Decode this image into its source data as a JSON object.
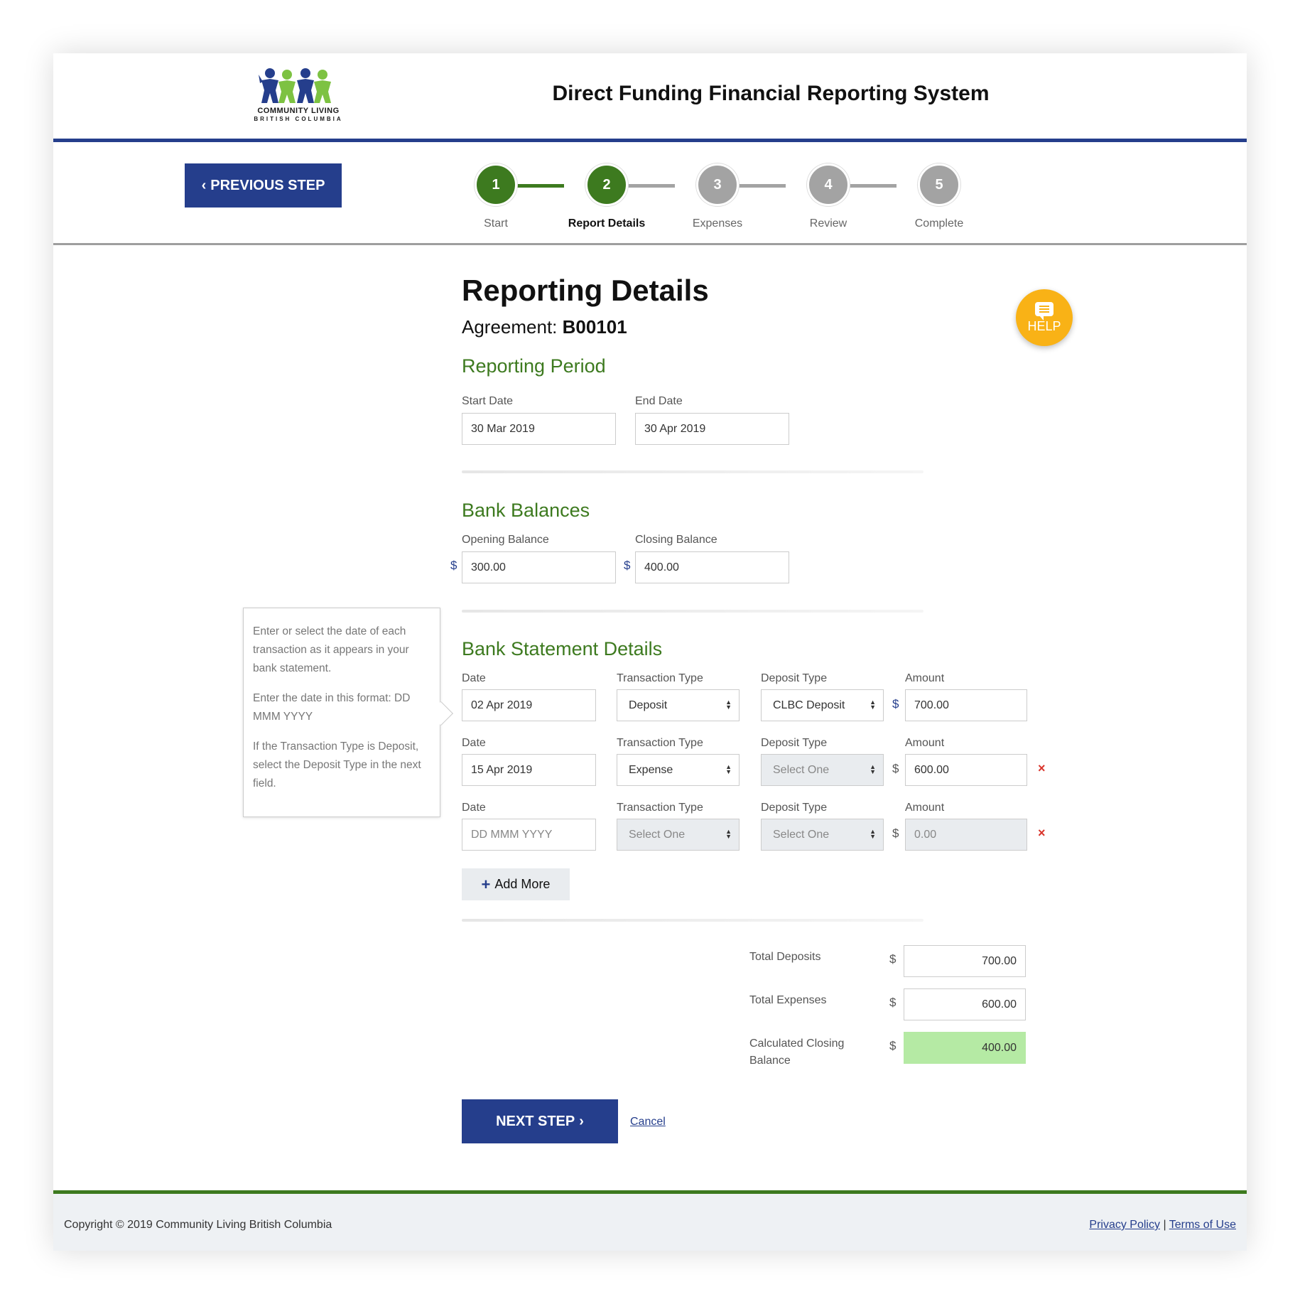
{
  "header": {
    "logo_line1": "COMMUNITY LIVING",
    "logo_line2": "BRITISH COLUMBIA",
    "system_title": "Direct Funding Financial Reporting System"
  },
  "nav": {
    "previous_label": "PREVIOUS STEP",
    "steps": [
      {
        "number": "1",
        "label": "Start",
        "state": "done"
      },
      {
        "number": "2",
        "label": "Report Details",
        "state": "active"
      },
      {
        "number": "3",
        "label": "Expenses",
        "state": "todo"
      },
      {
        "number": "4",
        "label": "Review",
        "state": "todo"
      },
      {
        "number": "5",
        "label": "Complete",
        "state": "todo"
      }
    ]
  },
  "page": {
    "title": "Reporting Details",
    "agreement_label": "Agreement:",
    "agreement_number": "B00101"
  },
  "reporting_period": {
    "title": "Reporting Period",
    "start_label": "Start Date",
    "start_value": "30 Mar 2019",
    "end_label": "End Date",
    "end_value": "30 Apr 2019"
  },
  "bank_balances": {
    "title": "Bank Balances",
    "opening_label": "Opening Balance",
    "opening_value": "300.00",
    "closing_label": "Closing Balance",
    "closing_value": "400.00",
    "currency": "$"
  },
  "statement": {
    "title": "Bank Statement Details",
    "col_date": "Date",
    "col_transaction": "Transaction Type",
    "col_deposit": "Deposit Type",
    "col_amount": "Amount",
    "rows": [
      {
        "date": "02 Apr 2019",
        "transaction": "Deposit",
        "deposit": "CLBC Deposit",
        "amount": "700.00"
      },
      {
        "date": "15 Apr 2019",
        "transaction": "Expense",
        "deposit": "Select One",
        "amount": "600.00"
      },
      {
        "date": "DD MMM YYYY",
        "transaction": "Select One",
        "deposit": "Select One",
        "amount": "0.00"
      }
    ],
    "remove_symbol": "×",
    "add_more_label": "Add More"
  },
  "tooltip": {
    "p1": "Enter or select the date of each transaction as it appears in your bank statement.",
    "p2": "Enter the date in this format: DD MMM YYYY",
    "p3": "If the Transaction Type is Deposit, select the Deposit Type in the next field."
  },
  "totals": {
    "deposits_label": "Total Deposits",
    "deposits_value": "700.00",
    "expenses_label": "Total Expenses",
    "expenses_value": "600.00",
    "closing_label": "Calculated Closing Balance",
    "closing_value": "400.00"
  },
  "actions": {
    "next_label": "NEXT STEP",
    "cancel_label": "Cancel"
  },
  "help": {
    "label": "HELP"
  },
  "footer": {
    "copyright": "Copyright © 2019 Community Living British Columbia",
    "privacy": "Privacy Policy",
    "separator": "|",
    "terms": "Terms of Use"
  },
  "colors": {
    "brand_blue": "#253e8c",
    "brand_green": "#3d7a1f",
    "step_todo": "#a3a3a3",
    "help_yellow": "#f9b216",
    "success_fill": "#b5eaa4",
    "danger": "#d9342b"
  }
}
